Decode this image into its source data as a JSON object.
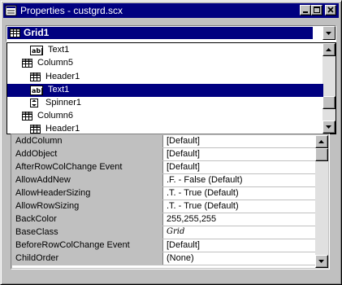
{
  "window": {
    "title": "Properties - custgrd.scx",
    "buttons": [
      "minimize",
      "maximize",
      "close"
    ]
  },
  "object_combo": {
    "selected": "Grid1"
  },
  "dropdown_items": [
    {
      "label": "Text1",
      "icon": "textbox-icon",
      "indent": 1,
      "selected": false
    },
    {
      "label": "Column5",
      "icon": "column-icon",
      "indent": 0,
      "selected": false
    },
    {
      "label": "Header1",
      "icon": "header-icon",
      "indent": 1,
      "selected": false
    },
    {
      "label": "Text1",
      "icon": "textbox-icon",
      "indent": 1,
      "selected": true
    },
    {
      "label": "Spinner1",
      "icon": "spinner-icon",
      "indent": 1,
      "selected": false
    },
    {
      "label": "Column6",
      "icon": "column-icon",
      "indent": 0,
      "selected": false
    },
    {
      "label": "Header1",
      "icon": "header-icon",
      "indent": 1,
      "selected": false
    }
  ],
  "properties": [
    {
      "name": "AddColumn",
      "value": "[Default]"
    },
    {
      "name": "AddObject",
      "value": "[Default]"
    },
    {
      "name": "AfterRowColChange Event",
      "value": "[Default]"
    },
    {
      "name": "AllowAddNew",
      "value": ".F. - False (Default)"
    },
    {
      "name": "AllowHeaderSizing",
      "value": ".T. - True (Default)"
    },
    {
      "name": "AllowRowSizing",
      "value": ".T. - True (Default)"
    },
    {
      "name": "BackColor",
      "value": "255,255,255"
    },
    {
      "name": "BaseClass",
      "value": "Grid",
      "italic": true
    },
    {
      "name": "BeforeRowColChange Event",
      "value": "[Default]"
    },
    {
      "name": "ChildOrder",
      "value": "(None)"
    }
  ],
  "colors": {
    "titlebar": "#000080",
    "selection": "#000080",
    "face": "#c0c0c0"
  }
}
